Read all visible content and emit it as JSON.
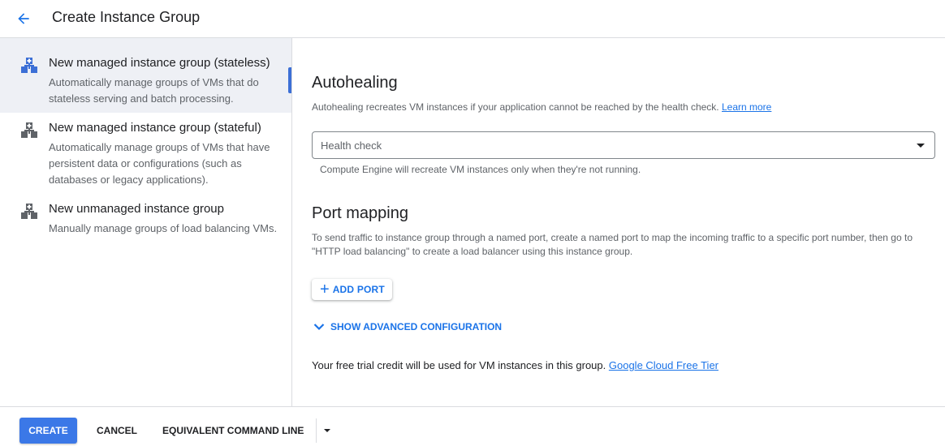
{
  "header": {
    "title": "Create Instance Group",
    "back_icon": "arrow-back-icon"
  },
  "sidebar": {
    "items": [
      {
        "title": "New managed instance group (stateless)",
        "description": "Automatically manage groups of VMs that do stateless serving and batch processing.",
        "icon": "instance-group-icon",
        "selected": true
      },
      {
        "title": "New managed instance group (stateful)",
        "description": "Automatically manage groups of VMs that have persistent data or configurations (such as databases or legacy applications).",
        "icon": "instance-group-icon",
        "selected": false
      },
      {
        "title": "New unmanaged instance group",
        "description": "Manually manage groups of load balancing VMs.",
        "icon": "instance-group-icon",
        "selected": false
      }
    ]
  },
  "autohealing": {
    "title": "Autohealing",
    "description": "Autohealing recreates VM instances if your application cannot be reached by the health check.",
    "learn_more": "Learn more",
    "health_check_placeholder": "Health check",
    "helper": "Compute Engine will recreate VM instances only when they're not running."
  },
  "port_mapping": {
    "title": "Port mapping",
    "description_line1": "To send traffic to instance group through a named port, create a named port to map the incoming traffic to a specific port number, then go to",
    "description_line2": "\"HTTP load balancing\" to create a load balancer using this instance group.",
    "add_port_label": "ADD PORT"
  },
  "advanced": {
    "label": "SHOW ADVANCED CONFIGURATION"
  },
  "trial": {
    "text": "Your free trial credit will be used for VM instances in this group.",
    "link": "Google Cloud Free Tier"
  },
  "footer": {
    "create_label": "CREATE",
    "cancel_label": "CANCEL",
    "command_line_label": "EQUIVALENT COMMAND LINE"
  },
  "colors": {
    "accent": "#1a73e8",
    "primary_button": "#3b78e7",
    "selected_bg": "#eef0f5"
  }
}
